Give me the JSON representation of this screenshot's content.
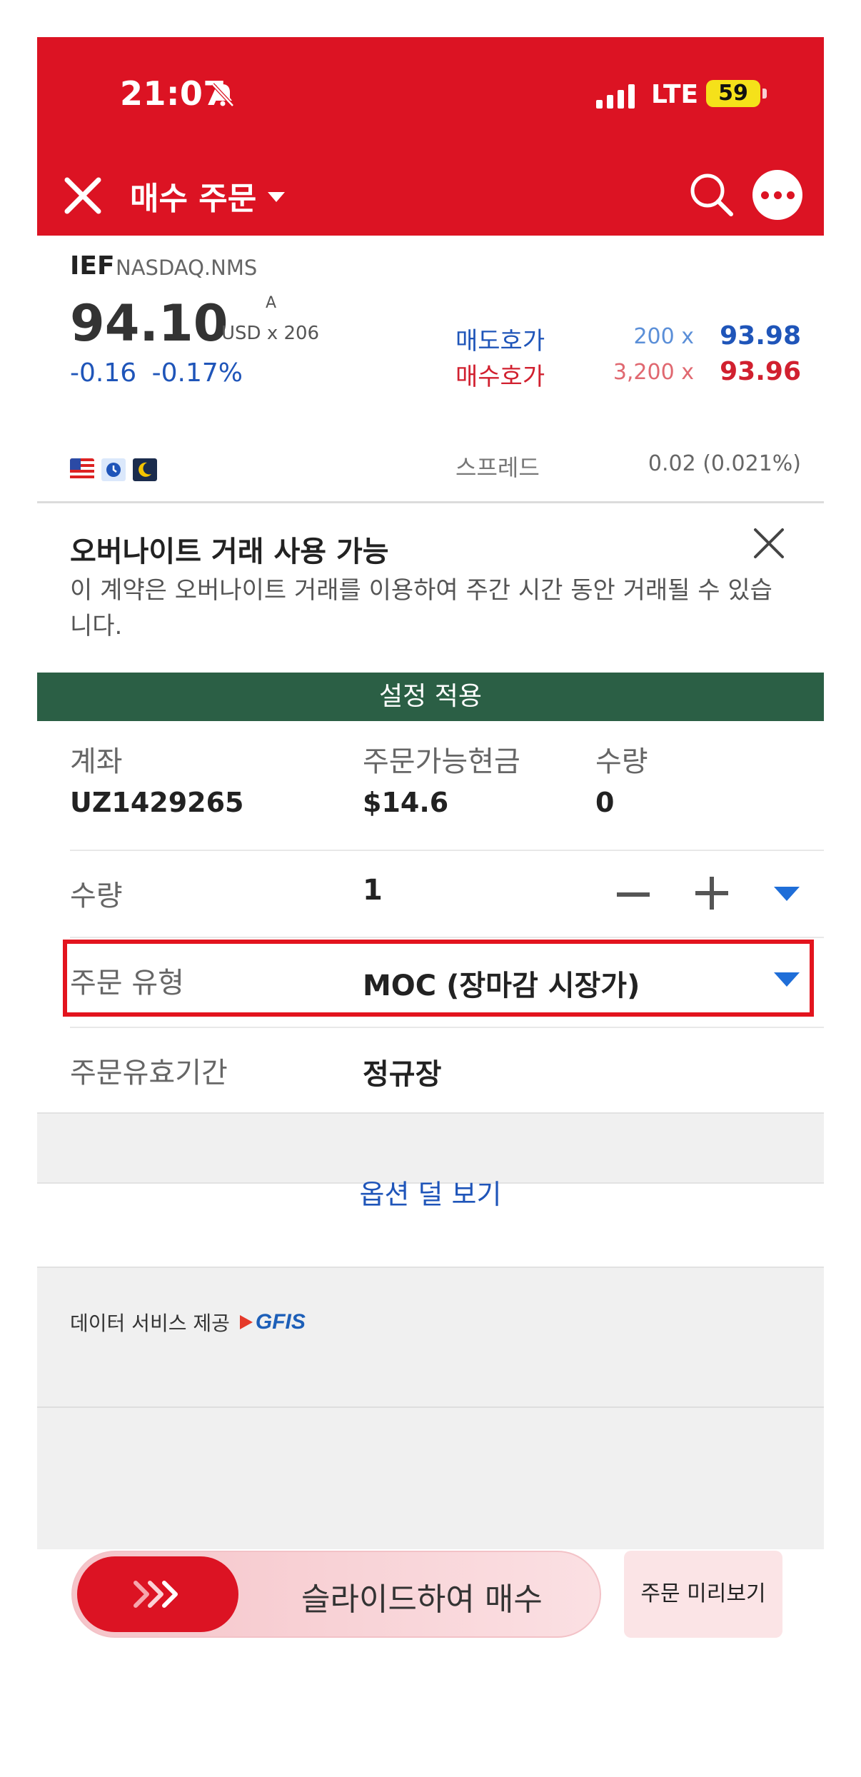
{
  "status_bar": {
    "time": "21:07",
    "network": "LTE",
    "battery": "59"
  },
  "header": {
    "title": "매수 주문"
  },
  "quote": {
    "symbol": "IEF",
    "exchange": "NASDAQ.NMS",
    "price": "94.10",
    "price_flag": "A",
    "currency_size": "USD x 206",
    "change": "-0.16",
    "change_pct": "-0.17%",
    "ask_label": "매도호가",
    "ask_qty": "200 x",
    "ask_price": "93.98",
    "bid_label": "매수호가",
    "bid_qty": "3,200 x",
    "bid_price": "93.96",
    "spread_label": "스프레드",
    "spread_value": "0.02 (0.021%)"
  },
  "notice": {
    "title": "오버나이트 거래 사용 가능",
    "body": "이 계약은 오버나이트 거래를 이용하여 주간 시간 동안 거래될 수 있습니다."
  },
  "apply_settings": "설정 적용",
  "account": {
    "account_label": "계좌",
    "account_value": "UZ1429265",
    "cash_label": "주문가능현금",
    "cash_value": "$14.6",
    "qty_label": "수량",
    "qty_value": "0"
  },
  "order": {
    "quantity_label": "수량",
    "quantity_value": "1",
    "type_label": "주문 유형",
    "type_value": "MOC (장마감 시장가)",
    "tif_label": "주문유효기간",
    "tif_value": "정규장"
  },
  "less_options": "옵션 덜 보기",
  "data_provider": {
    "label": "데이터 서비스 제공",
    "logo_text": "GFIS"
  },
  "bottom": {
    "slide_label": "슬라이드하여 매수",
    "preview_label": "주문 미리보기"
  },
  "colors": {
    "brand_red": "#dc1323",
    "blue": "#1f55b9",
    "green_bar": "#2b5f45"
  }
}
